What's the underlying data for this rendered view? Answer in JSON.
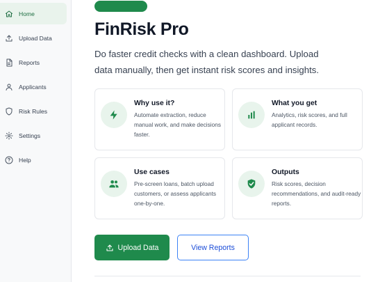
{
  "sidebar": {
    "items": [
      {
        "label": "Home",
        "icon": "home-icon",
        "active": true
      },
      {
        "label": "Upload Data",
        "icon": "upload-icon",
        "active": false
      },
      {
        "label": "Reports",
        "icon": "document-icon",
        "active": false
      },
      {
        "label": "Applicants",
        "icon": "user-icon",
        "active": false
      },
      {
        "label": "Risk Rules",
        "icon": "shield-icon",
        "active": false
      },
      {
        "label": "Settings",
        "icon": "gear-icon",
        "active": false
      },
      {
        "label": "Help",
        "icon": "help-circle-icon",
        "active": false
      }
    ]
  },
  "main": {
    "title": "FinRisk Pro",
    "subtitle": "Do faster credit checks with a clean dashboard. Upload data manually, then get instant risk scores and insights.",
    "cards": [
      {
        "title": "Why use it?",
        "body": "Automate extraction, reduce manual work, and make decisions faster.",
        "icon": "lightning-icon"
      },
      {
        "title": "What you get",
        "body": "Analytics, risk scores, and full applicant records.",
        "icon": "bar-chart-icon"
      },
      {
        "title": "Use cases",
        "body": "Pre-screen loans, batch upload customers, or assess applicants one-by-one.",
        "icon": "users-icon"
      },
      {
        "title": "Outputs",
        "body": "Risk scores, decision recommendations, and audit-ready reports.",
        "icon": "shield-check-icon"
      }
    ],
    "buttons": {
      "upload_label": "Upload Data",
      "reports_label": "View Reports"
    }
  },
  "colors": {
    "brand_green": "#1f8a4c",
    "active_nav_bg": "#e9f3ec",
    "icon_circle_bg": "#e8f4ec",
    "secondary_border": "#3b82f6"
  }
}
